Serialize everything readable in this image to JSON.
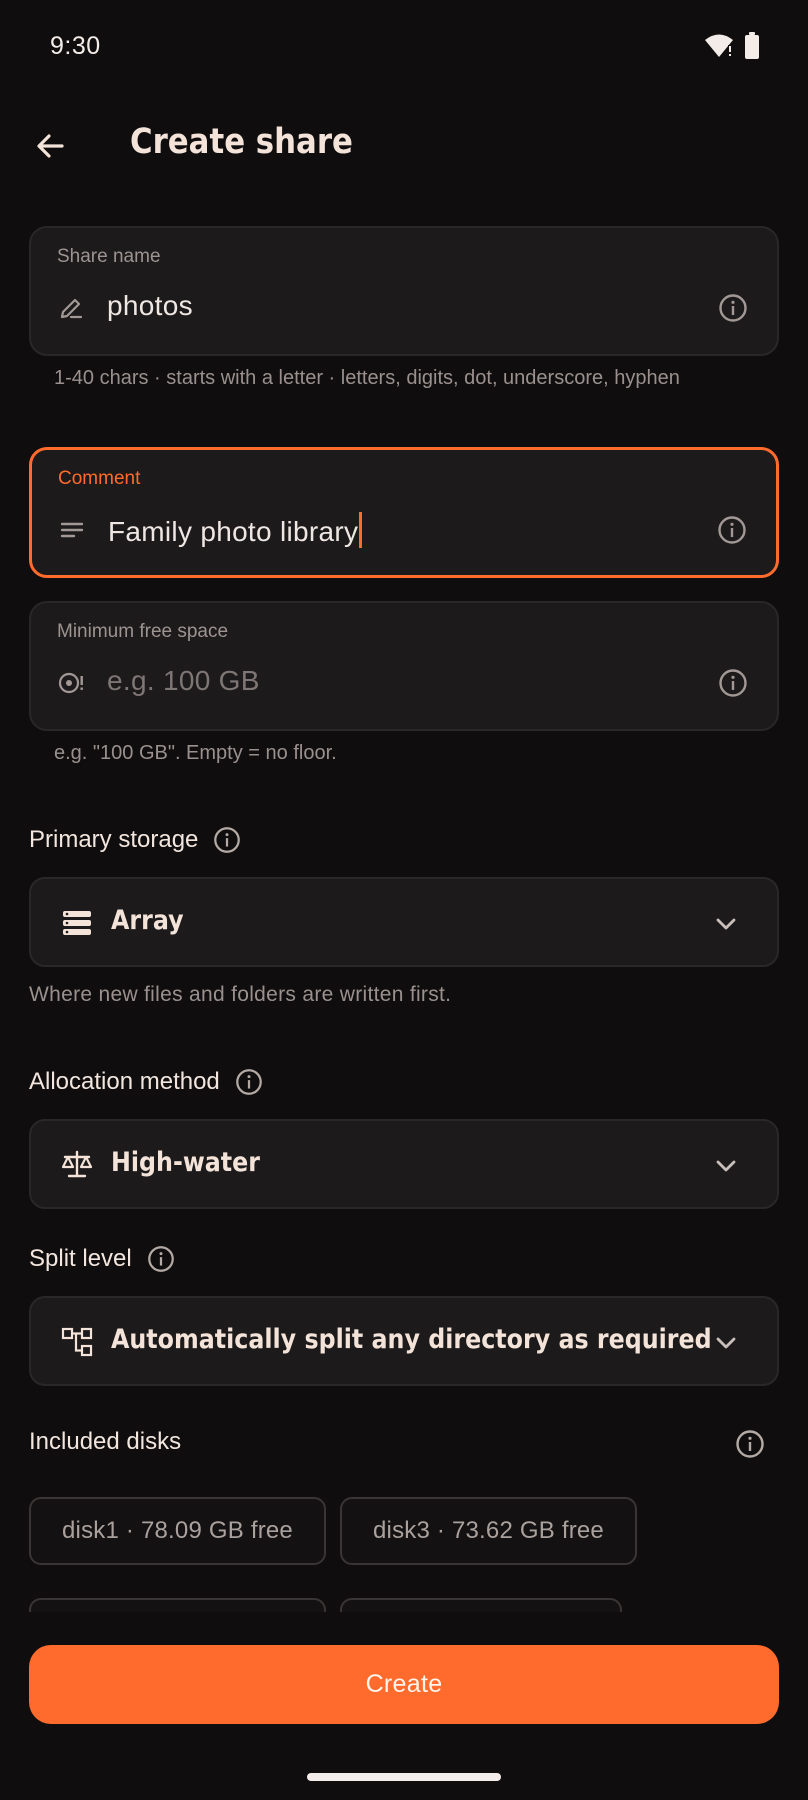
{
  "status_bar": {
    "time": "9:30"
  },
  "app_bar": {
    "title": "Create share"
  },
  "share_name": {
    "label": "Share name",
    "value": "photos",
    "helper": "1-40 chars · starts with a letter · letters, digits, dot, underscore, hyphen"
  },
  "comment": {
    "label": "Comment",
    "value": "Family photo library"
  },
  "min_free_space": {
    "label": "Minimum free space",
    "placeholder": "e.g. 100 GB",
    "helper": "e.g. \"100 GB\". Empty = no floor."
  },
  "primary_storage": {
    "label": "Primary storage",
    "value": "Array",
    "helper": "Where new files and folders are written first."
  },
  "allocation_method": {
    "label": "Allocation method",
    "value": "High-water"
  },
  "split_level": {
    "label": "Split level",
    "value": "Automatically split any directory as required"
  },
  "included_disks": {
    "label": "Included disks",
    "chips": [
      {
        "label": "disk1 · 78.09 GB free"
      },
      {
        "label": "disk3 · 73.62 GB free"
      },
      {
        "label": ""
      },
      {
        "label": ""
      }
    ]
  },
  "actions": {
    "create": "Create"
  },
  "colors": {
    "accent": "#ff6b2c",
    "background": "#0f0d0d",
    "surface": "#1c1a1a"
  }
}
